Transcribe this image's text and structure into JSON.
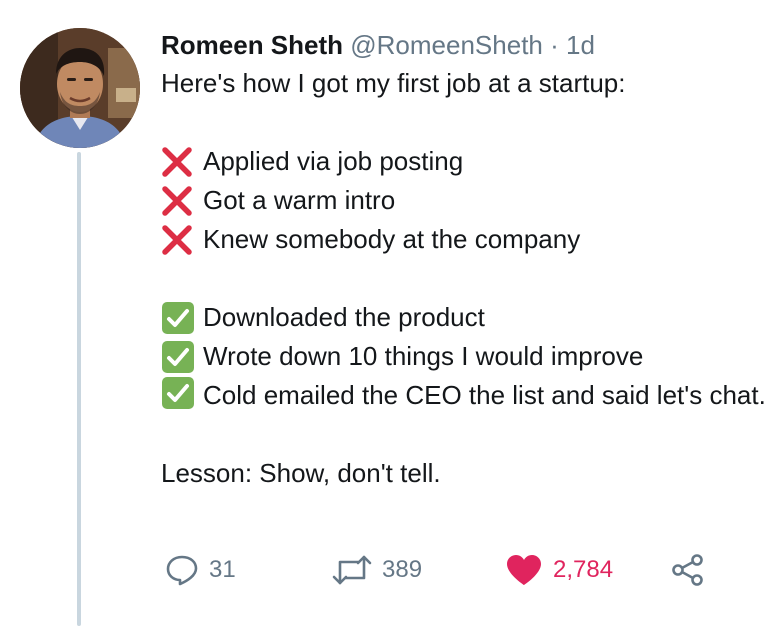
{
  "tweet": {
    "author_name": "Romeen Sheth",
    "handle": "@RomeenSheth",
    "separator": "·",
    "time": "1d",
    "intro": "Here's how I got my first job at a startup:",
    "crossed": [
      "Applied via job posting",
      "Got a warm intro",
      "Knew somebody at the company"
    ],
    "checked": [
      "Downloaded the product",
      "Wrote down 10 things I would improve",
      "Cold emailed the CEO the list and said let's chat."
    ],
    "lesson": "Lesson: Show, don't tell."
  },
  "actions": {
    "replies": "31",
    "retweets": "389",
    "likes": "2,784"
  },
  "colors": {
    "cross": "#dd2e44",
    "check_bg": "#77b255",
    "like": "#e0245e",
    "muted": "#657786",
    "thread_line": "#c9d6df"
  }
}
